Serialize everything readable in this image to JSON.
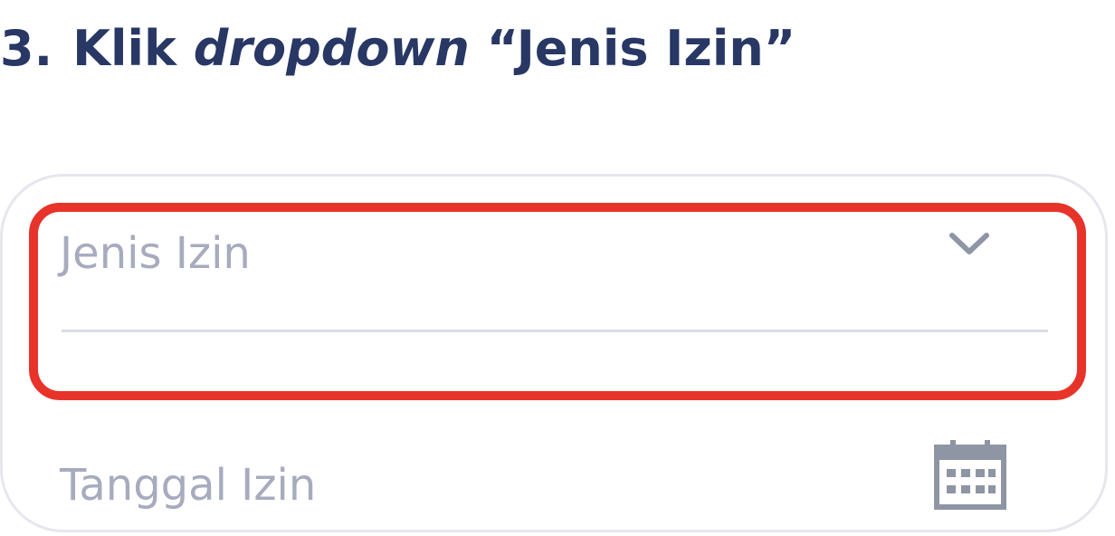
{
  "instruction": {
    "number": "3.",
    "prefix": "Klik",
    "emphasis": "dropdown",
    "suffix": "“Jenis Izin”"
  },
  "form": {
    "jenis_izin": {
      "placeholder": "Jenis Izin",
      "icon": "chevron-down-icon"
    },
    "tanggal_izin": {
      "placeholder": "Tanggal Izin",
      "icon": "calendar-icon"
    }
  },
  "colors": {
    "title": "#283764",
    "highlight": "#e8332a",
    "placeholder": "#a7abbe",
    "icon": "#8e95a4",
    "border": "#e6e7ee"
  }
}
